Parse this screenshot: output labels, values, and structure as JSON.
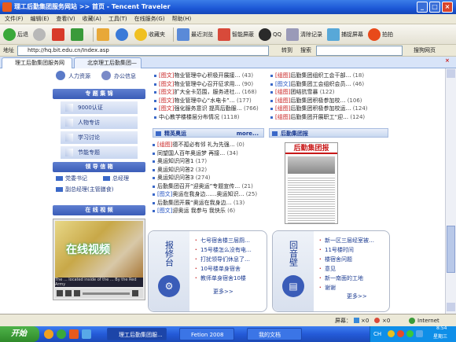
{
  "window": {
    "title": "理工后勤集团服务网站 >> 首页 - Tencent Traveler",
    "min": "_",
    "max": "□",
    "close": "×"
  },
  "menu": [
    "文件(F)",
    "编辑(E)",
    "查看(V)",
    "收藏(A)",
    "工具(T)",
    "在线服务(G)",
    "帮助(H)"
  ],
  "toolbar": {
    "back": "后退",
    "favorites": "收藏夹",
    "recent": "最近浏览",
    "smartscreen": "智能屏蔽",
    "qq": "QQ",
    "clear": "清除记录",
    "capture": "捕捉屏幕",
    "cut": "拍拍"
  },
  "address": {
    "label": "地址",
    "url": "http://hq.bit.edu.cn/Index.asp",
    "go": "转到",
    "search_label": "搜索",
    "search_btn": "搜狗网页"
  },
  "tabs": [
    {
      "label": "理工后勤集团服务网"
    },
    {
      "label": "北京理工后勤集团—后"
    }
  ],
  "left": {
    "top_links": [
      "人力资源",
      "办公信息"
    ],
    "special_title": "专 题 集 锦",
    "special_items": [
      "9000认证",
      "人物专访",
      "学习讨论",
      "节能专题"
    ],
    "leader_title": "领 导 信 箱",
    "leader_items": [
      "党委书记",
      "总经理",
      "副总经理(主管膳食)"
    ],
    "video_title": "在 线 视 频",
    "video_caption": "在线视频",
    "video_sub": "The ... located inside of the ... By the Red Army"
  },
  "news_top_left": [
    {
      "tag": "[图文]",
      "text": "物业管理中心积极开展接…",
      "num": "(43)"
    },
    {
      "tag": "[图文]",
      "text": "物业管理中心召开征求用…",
      "num": "(90)"
    },
    {
      "tag": "[图文]",
      "text": "扩大全卡范围，服务进社…",
      "num": "(168)"
    },
    {
      "tag": "[图文]",
      "text": "物业管理中心“水电卡”…",
      "num": "(177)"
    },
    {
      "tag": "[图文]",
      "text": "强化服务意识 提高后勤服…",
      "num": "(766)"
    },
    {
      "tag": "",
      "text": "中心教学楼楼层分布情况",
      "num": "(1118)"
    }
  ],
  "news_top_right": [
    {
      "tag": "[组图]",
      "text": "后勤集团组织工会干部…",
      "num": "(18)"
    },
    {
      "tag": "[图文]",
      "text": "后勤集团工会组织会员…",
      "num": "(46)"
    },
    {
      "tag": "[组图]",
      "text": "团结抗雪暴",
      "num": "(122)"
    },
    {
      "tag": "[组图]",
      "text": "后勤集团积极参加校…",
      "num": "(106)"
    },
    {
      "tag": "[组图]",
      "text": "后勤集团积极参加校运…",
      "num": "(124)"
    },
    {
      "tag": "[组图]",
      "text": "后勤集团开展职工“迎…",
      "num": "(124)"
    }
  ],
  "olympic": {
    "title": "精英奥运",
    "more": "more...",
    "items": [
      {
        "tag": "[组图]",
        "text": "德不孤必有邻  礼为先强…",
        "num": "(0)"
      },
      {
        "tag": "",
        "text": "同望国人百年奥运梦 再接…",
        "num": "(34)"
      },
      {
        "tag": "",
        "text": "奥运知识问答1",
        "num": "(17)"
      },
      {
        "tag": "",
        "text": "奥运知识问答2",
        "num": "(32)"
      },
      {
        "tag": "",
        "text": "奥运知识问答3",
        "num": "(274)"
      },
      {
        "tag": "",
        "text": "后勤集团召开“迎奥运”专题宣传…",
        "num": "(21)"
      },
      {
        "tag": "[图文]",
        "text": "奥运在我身边……奥运知识…",
        "num": "(25)"
      },
      {
        "tag": "",
        "text": "后勤集团开展“奥运在我身边…",
        "num": "(13)"
      },
      {
        "tag": "[图文]",
        "text": "迎奥运  我参与  我快乐",
        "num": "(6)"
      }
    ]
  },
  "paper": {
    "title": "后勤集团报",
    "masthead": "后勤集团报"
  },
  "report": {
    "side_label": "报修台",
    "items": [
      "七号宿舍楼三层厕…",
      "15号楼怎么没有电…",
      "打扰领导们休息了…",
      "10号楼单身宿舍",
      "教师单身宿舍10楼"
    ],
    "more": "更多>>"
  },
  "feedback": {
    "side_label": "回音壁",
    "items": [
      "新一区三层经室被…",
      "11号楼时间",
      "楼宿舍问题",
      "意见",
      "新一南面的工地",
      "谢谢"
    ],
    "more": "更多>>"
  },
  "status": {
    "screen_label": "屏幕：",
    "count1": "×0",
    "count2": "×0",
    "zone": "Internet"
  },
  "taskbar": {
    "start": "开始",
    "tasks": [
      "理工后勤集团服...",
      "Fetion 2008",
      "我的文档"
    ],
    "lang": "CH",
    "time": "8:54",
    "day": "星期三"
  }
}
